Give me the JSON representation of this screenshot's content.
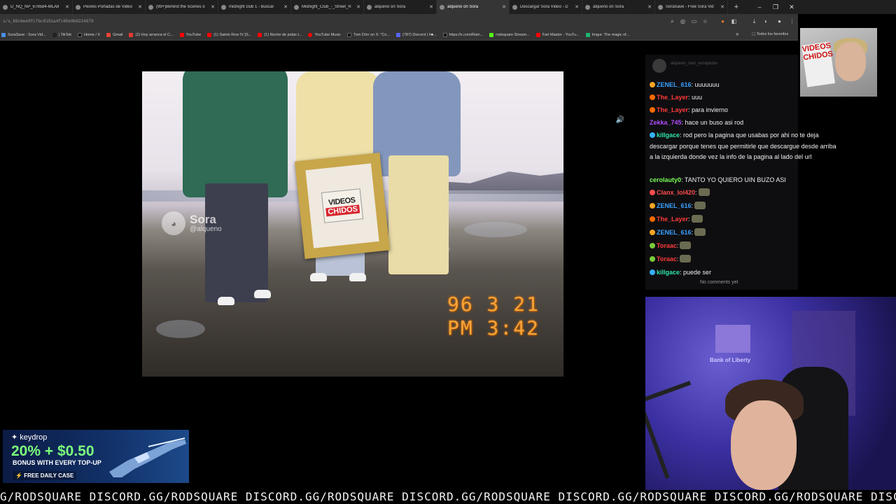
{
  "tabs": [
    {
      "label": "D_NQ_NP_678584-MLA8"
    },
    {
      "label": "Peores Portadas de Video"
    },
    {
      "label": "(99+)Behind the Scenes o"
    },
    {
      "label": "midnight club 1 - Buscar"
    },
    {
      "label": "Midnight_Club_-_Street_R"
    },
    {
      "label": "alqueno on Sora"
    },
    {
      "label": "alqueno on Sora"
    },
    {
      "label": "Descargar Sora Video - D"
    },
    {
      "label": "alqueno on Sora"
    },
    {
      "label": "SoraSave - Free Sora Vid"
    }
  ],
  "window_controls": {
    "minimize": "–",
    "maximize": "❐",
    "close": "✕",
    "new_tab": "+"
  },
  "address": {
    "url": "s/s_69c6ee9fc7bc8191a4fc60e9b0224979"
  },
  "bookmarks": [
    {
      "label": "SoraSave - Sora Vid...",
      "color": "#4a90e2"
    },
    {
      "label": "| TikTok",
      "color": "#222222"
    },
    {
      "label": "Home / X",
      "color": "#111111"
    },
    {
      "label": "Gmail",
      "color": "#ea4335"
    },
    {
      "label": "(2) Hoy arranca el C...",
      "color": "#e53935"
    },
    {
      "label": "YouTube",
      "color": "#ff0000"
    },
    {
      "label": "(1) Saints Row IV [S...",
      "color": "#ff0000"
    },
    {
      "label": "(1) Noche de jodas t...",
      "color": "#ff0000"
    },
    {
      "label": "YouTube Music",
      "color": "#ff0000"
    },
    {
      "label": "Tom Dörr on X: \"Co...",
      "color": "#111111"
    },
    {
      "label": "(787) Discord | #■...",
      "color": "#5865f2"
    },
    {
      "label": "https://x.com/Rain...",
      "color": "#111111"
    },
    {
      "label": "rodsquare Stream...",
      "color": "#53fc18"
    },
    {
      "label": "Fart Master - YouTu...",
      "color": "#ff0000"
    },
    {
      "label": "Imgur: The magic of...",
      "color": "#1bb76e"
    }
  ],
  "bookmarks_more": "»",
  "bookmarks_folder": "Todos los favoritos",
  "video": {
    "watermark_name": "Sora",
    "watermark_handle": "@alqueno",
    "vhs_date": "96  3 21",
    "vhs_time": "PM  3:42",
    "sign_line1": "VIDEOS",
    "sign_line2": "CHIDOS",
    "volume_icon": "🔊"
  },
  "chat": {
    "header_user": "alqueno_cool_sonoptubo",
    "messages": [
      {
        "user": "ZENEL_616",
        "color": "#3aa0ff",
        "badge": "#f5a623",
        "text": ": uuuuuuu"
      },
      {
        "user": "The_Layer",
        "color": "#ff3b3b",
        "badge": "#ff6a00",
        "text": ": uuu"
      },
      {
        "user": "The_Layer",
        "color": "#ff3b3b",
        "badge": "#ff6a00",
        "text": ": para invierno"
      },
      {
        "user": "Zekka_745",
        "color": "#b34dff",
        "badge": "",
        "text": ": hace un buso asi rod"
      },
      {
        "user": "killgace",
        "color": "#2ee6a8",
        "badge": "#36b0ff",
        "text": ": rod pero la pagina que usabas por ahi no te deja descargar porque tenes que permitirle que descargue desde arriba a la izquierda donde vez la info de la pagina al lado del url"
      },
      {
        "user": "cerolauty0",
        "color": "#7aff5a",
        "badge": "",
        "text": ": TANTO YO QUIERO UIN BUZO ASI"
      },
      {
        "user": "Clanx_lol420",
        "color": "#ff4d4d",
        "badge": "#ff4d4d",
        "text": ":"
      },
      {
        "user": "ZENEL_616",
        "color": "#3aa0ff",
        "badge": "#f5a623",
        "text": ":"
      },
      {
        "user": "The_Layer",
        "color": "#ff3b3b",
        "badge": "#ff6a00",
        "text": ":"
      },
      {
        "user": "ZENEL_616",
        "color": "#3aa0ff",
        "badge": "#f5a623",
        "text": ":"
      },
      {
        "user": "Toraac",
        "color": "#ff3b3b",
        "badge": "#7acb3a",
        "text": ":"
      },
      {
        "user": "Toraac",
        "color": "#ff3b3b",
        "badge": "#7acb3a",
        "text": ":"
      },
      {
        "user": "killgace",
        "color": "#2ee6a8",
        "badge": "#36b0ff",
        "text": ": puede ser"
      }
    ],
    "empty_state": "No comments yet"
  },
  "top_cam": {
    "sign_line1": "VIDEOS",
    "sign_line2": "CHIDOS"
  },
  "main_cam": {
    "wall_text": "Bank of Liberty"
  },
  "ad": {
    "brand": "keydrop",
    "promo": "20% + $0.50",
    "bonus": "BONUS WITH EVERY TOP-UP",
    "cta": "FREE DAILY CASE"
  },
  "ticker": {
    "text": "G/RODSQUARE  DISCORD.GG/RODSQUARE  DISCORD.GG/RODSQUARE  DISCORD.GG/RODSQUARE  DISCORD.GG/RODSQUARE  DISCORD.GG/RODSQUARE  DISCORD.GG/RODSQUARE"
  }
}
